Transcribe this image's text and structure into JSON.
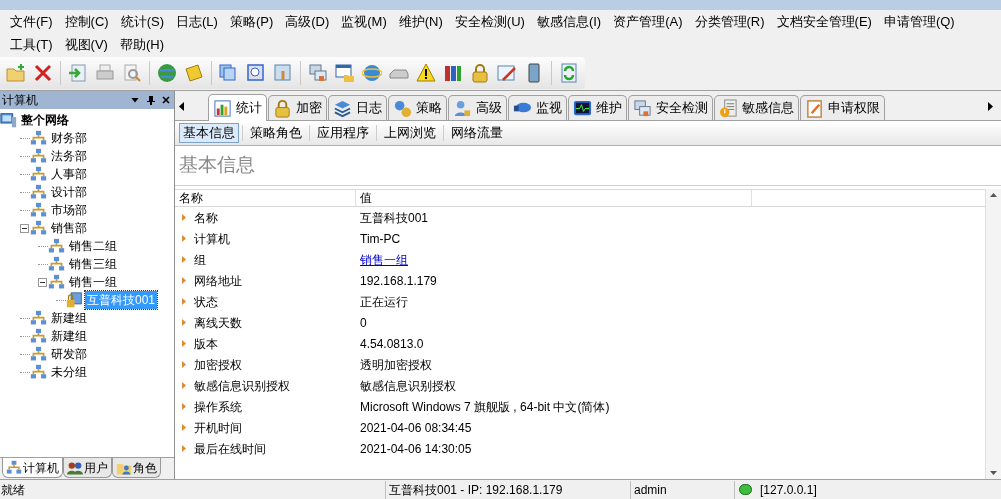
{
  "menu_bar": [
    [
      "文件(F)",
      "控制(C)",
      "统计(S)",
      "日志(L)",
      "策略(P)",
      "高级(D)",
      "监视(M)",
      "维护(N)",
      "安全检测(U)",
      "敏感信息(I)",
      "资产管理(A)",
      "分类管理(R)",
      "文档安全管理(E)",
      "申请管理(Q)"
    ],
    [
      "工具(T)",
      "视图(V)",
      "帮助(H)"
    ]
  ],
  "sidebar": {
    "title": "计算机",
    "tree": [
      {
        "label": "整个网络",
        "kind": "root",
        "selected": false,
        "children": [
          {
            "label": "财务部",
            "kind": "group",
            "selected": false
          },
          {
            "label": "法务部",
            "kind": "group",
            "selected": false
          },
          {
            "label": "人事部",
            "kind": "group",
            "selected": false
          },
          {
            "label": "设计部",
            "kind": "group",
            "selected": false
          },
          {
            "label": "市场部",
            "kind": "group",
            "selected": false
          },
          {
            "label": "销售部",
            "kind": "group",
            "expanded": true,
            "selected": false,
            "children": [
              {
                "label": "销售二组",
                "kind": "group",
                "selected": false
              },
              {
                "label": "销售三组",
                "kind": "group",
                "selected": false
              },
              {
                "label": "销售一组",
                "kind": "group",
                "expanded": true,
                "selected": false,
                "children": [
                  {
                    "label": "互普科技001",
                    "kind": "computer",
                    "selected": true
                  }
                ]
              }
            ]
          },
          {
            "label": "新建组",
            "kind": "group",
            "selected": false
          },
          {
            "label": "新建组",
            "kind": "group",
            "selected": false
          },
          {
            "label": "研发部",
            "kind": "group",
            "selected": false
          },
          {
            "label": "未分组",
            "kind": "group",
            "selected": false
          }
        ]
      }
    ],
    "tabs": [
      {
        "label": "计算机",
        "selected": true
      },
      {
        "label": "用户",
        "selected": false
      },
      {
        "label": "角色",
        "selected": false
      }
    ]
  },
  "tabs": [
    {
      "label": "统计",
      "selected": true
    },
    {
      "label": "加密",
      "selected": false
    },
    {
      "label": "日志",
      "selected": false
    },
    {
      "label": "策略",
      "selected": false
    },
    {
      "label": "高级",
      "selected": false
    },
    {
      "label": "监视",
      "selected": false
    },
    {
      "label": "维护",
      "selected": false
    },
    {
      "label": "安全检测",
      "selected": false
    },
    {
      "label": "敏感信息",
      "selected": false
    },
    {
      "label": "申请权限",
      "selected": false
    }
  ],
  "sub_tabs": [
    {
      "label": "基本信息",
      "selected": true
    },
    {
      "label": "策略角色",
      "selected": false
    },
    {
      "label": "应用程序",
      "selected": false
    },
    {
      "label": "上网浏览",
      "selected": false
    },
    {
      "label": "网络流量",
      "selected": false
    }
  ],
  "section_title": "基本信息",
  "table": {
    "columns": [
      "名称",
      "值"
    ],
    "rows": [
      {
        "name": "名称",
        "value": "互普科技001"
      },
      {
        "name": "计算机",
        "value": "Tim-PC"
      },
      {
        "name": "组",
        "value": "销售一组",
        "kind": "link"
      },
      {
        "name": "网络地址",
        "value": "192.168.1.179"
      },
      {
        "name": "状态",
        "value": "正在运行"
      },
      {
        "name": "离线天数",
        "value": "0"
      },
      {
        "name": "版本",
        "value": "4.54.0813.0"
      },
      {
        "name": "加密授权",
        "value": "透明加密授权"
      },
      {
        "name": "敏感信息识别授权",
        "value": "敏感信息识别授权"
      },
      {
        "name": "操作系统",
        "value": "Microsoft Windows 7 旗舰版 , 64-bit 中文(简体)"
      },
      {
        "name": "开机时间",
        "value": "2021-04-06 08:34:45"
      },
      {
        "name": "最后在线时间",
        "value": "2021-04-06 14:30:05"
      }
    ]
  },
  "status_bar": {
    "status": "就绪",
    "computer": "互普科技001 - IP: 192.168.1.179",
    "user": "admin",
    "server": "[127.0.0.1]",
    "connected": true
  }
}
